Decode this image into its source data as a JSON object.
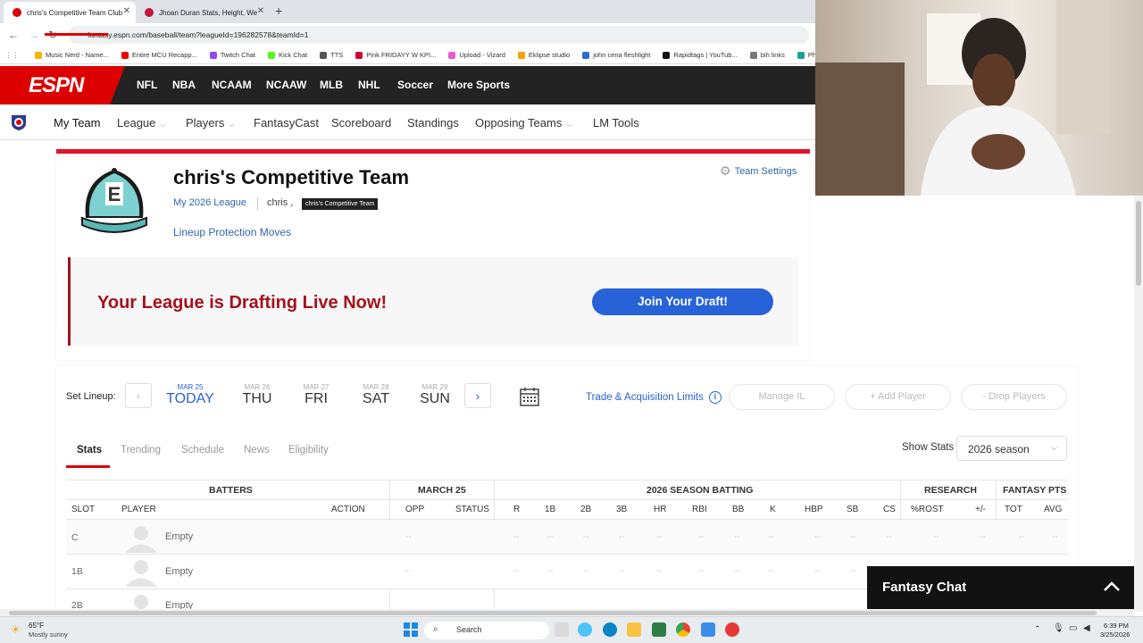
{
  "browser": {
    "tabs": [
      {
        "title": "chris's Competitive Team Club"
      },
      {
        "title": "Jhoan Duran Stats, Height, We"
      }
    ],
    "url": "fantasy.espn.com/baseball/team?leagueId=196282578&teamId=1",
    "bookmarks": [
      "Music Nerd - Name...",
      "Entire MCU Recapp...",
      "Twitch Chat",
      "Kick Chat",
      "TTS",
      "Pink FRIDAYY W KPI...",
      "Upload - Vizard",
      "Eklipse studio",
      "john cena fleshlight",
      "Rapidtags | YouTub...",
      "bih links",
      "Photopea"
    ]
  },
  "espn": {
    "logo": "ESPN",
    "sports": [
      "NFL",
      "NBA",
      "NCAAM",
      "NCAAW",
      "MLB",
      "NHL",
      "Soccer",
      "More Sports"
    ]
  },
  "subnav": {
    "items": [
      {
        "label": "My Team"
      },
      {
        "label": "League"
      },
      {
        "label": "Players"
      },
      {
        "label": "FantasyCast"
      },
      {
        "label": "Scoreboard"
      },
      {
        "label": "Standings"
      },
      {
        "label": "Opposing Teams"
      },
      {
        "label": "LM Tools"
      }
    ]
  },
  "team": {
    "name": "chris's Competitive Team",
    "league": "My 2026 League",
    "owner": "chris ,",
    "tooltip": "chris's Competitive Team",
    "lineup_protection": "Lineup Protection Moves",
    "settings": "Team Settings"
  },
  "draft": {
    "message": "Your League is Drafting Live Now!",
    "button": "Join Your Draft!"
  },
  "lineup": {
    "set_label": "Set Lineup:",
    "days": [
      {
        "date": "MAR 25",
        "day": "TODAY"
      },
      {
        "date": "MAR 26",
        "day": "THU"
      },
      {
        "date": "MAR 27",
        "day": "FRI"
      },
      {
        "date": "MAR 28",
        "day": "SAT"
      },
      {
        "date": "MAR 29",
        "day": "SUN"
      }
    ],
    "trade_limits": "Trade & Acquisition Limits",
    "manage_il": "Manage IL",
    "add_player": "+ Add Player",
    "drop_players": "- Drop Players"
  },
  "stat_tabs": [
    "Stats",
    "Trending",
    "Schedule",
    "News",
    "Eligibility"
  ],
  "show_stats": {
    "label": "Show Stats",
    "value": "2026 season"
  },
  "table": {
    "group_headers": [
      "BATTERS",
      "MARCH 25",
      "2026 SEASON BATTING",
      "RESEARCH",
      "FANTASY PTS"
    ],
    "columns": [
      "SLOT",
      "PLAYER",
      "ACTION",
      "OPP",
      "STATUS",
      "R",
      "1B",
      "2B",
      "3B",
      "HR",
      "RBI",
      "BB",
      "K",
      "HBP",
      "SB",
      "CS",
      "%ROST",
      "+/-",
      "TOT",
      "AVG"
    ],
    "rows": [
      {
        "slot": "C",
        "player": "Empty"
      },
      {
        "slot": "1B",
        "player": "Empty"
      },
      {
        "slot": "2B",
        "player": "Empty"
      }
    ],
    "placeholder": "--"
  },
  "chat": {
    "title": "Fantasy Chat"
  },
  "taskbar": {
    "temp": "65°F",
    "condition": "Mostly sunny",
    "search": "Search",
    "time": "6:39 PM",
    "date": "3/25/2026"
  }
}
